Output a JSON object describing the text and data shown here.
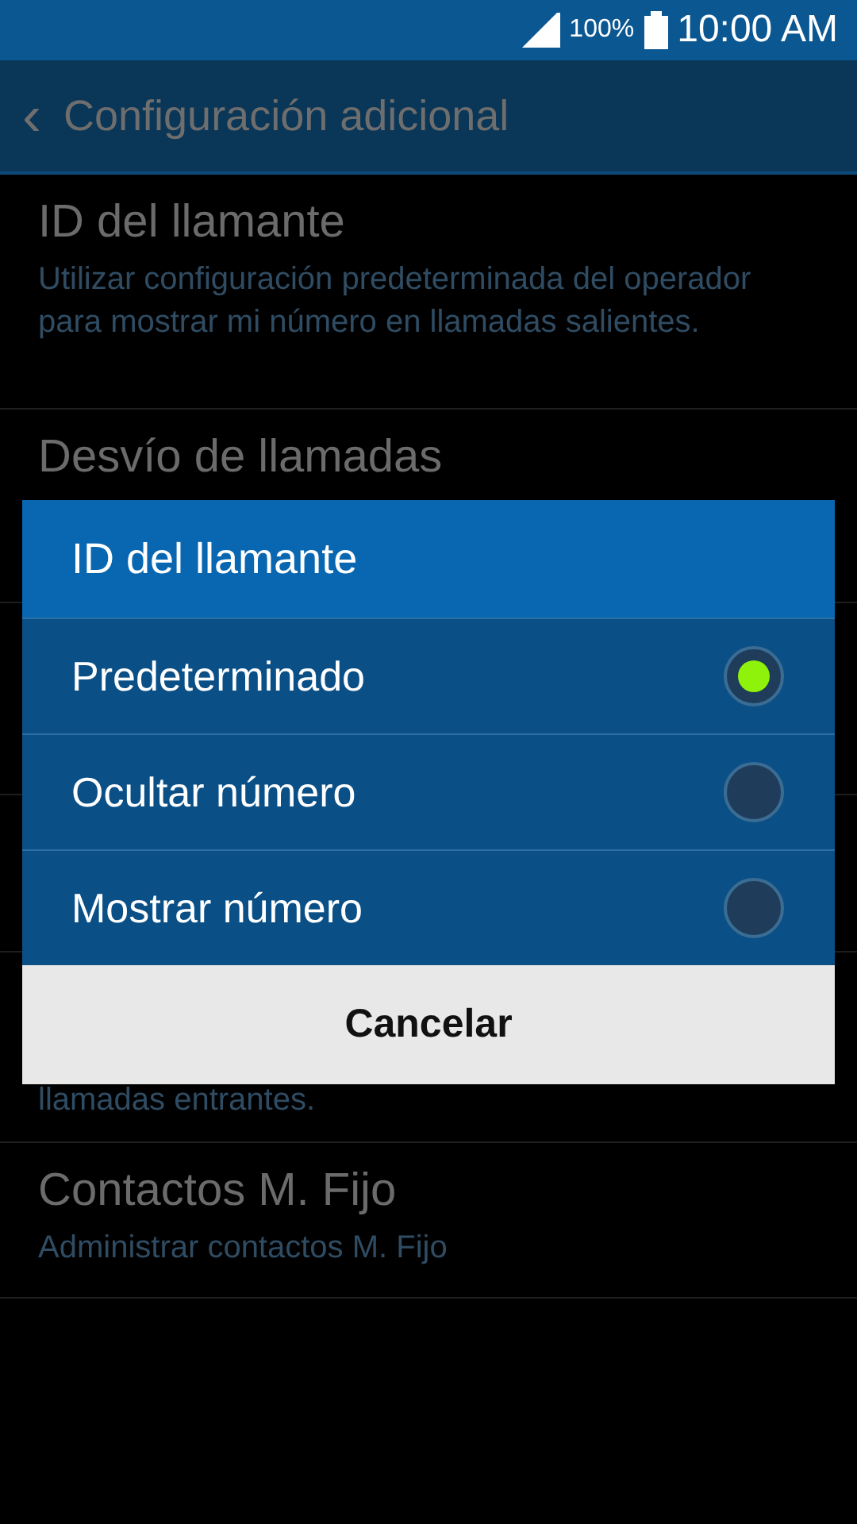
{
  "status_bar": {
    "battery_text": "100%",
    "time": "10:00 AM"
  },
  "header": {
    "back_icon": "‹",
    "title": "Configuración adicional"
  },
  "settings": [
    {
      "title": "ID del llamante",
      "description": "Utilizar configuración predeterminada del operador para mostrar mi número en llamadas salientes."
    },
    {
      "title": "Desvío de llamadas"
    },
    {
      "description": "llamadas entrantes."
    },
    {
      "title": "Contactos M. Fijo",
      "description": "Administrar contactos M. Fijo"
    }
  ],
  "dialog": {
    "title": "ID del llamante",
    "options": [
      {
        "label": "Predeterminado",
        "selected": true
      },
      {
        "label": "Ocultar número",
        "selected": false
      },
      {
        "label": "Mostrar número",
        "selected": false
      }
    ],
    "cancel": "Cancelar"
  }
}
